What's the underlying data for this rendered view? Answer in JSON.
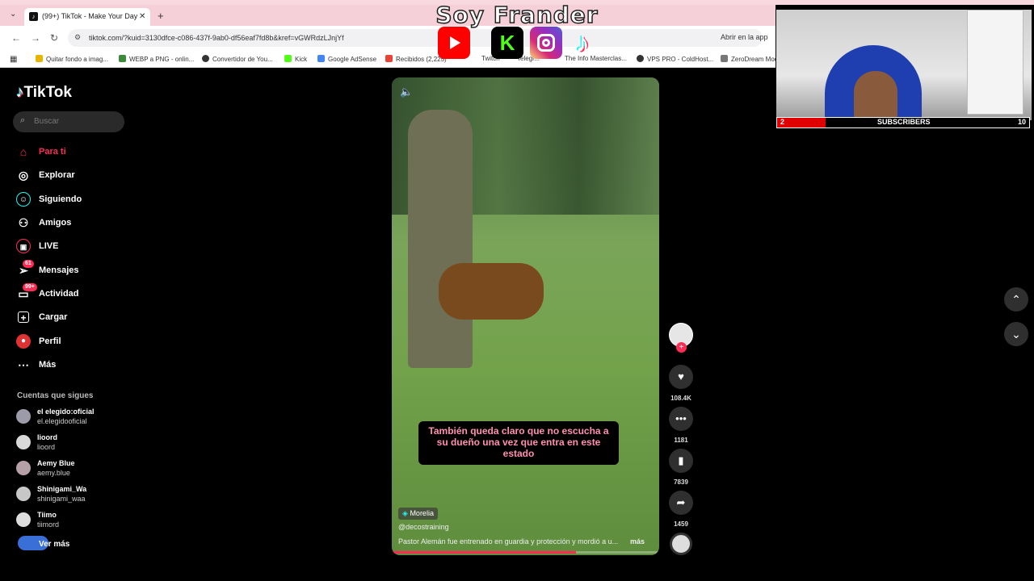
{
  "browser": {
    "tab_title": "(99+) TikTok - Make Your Day",
    "url": "tiktok.com/?kuid=3130dfce-c086-437f-9ab0-df56eaf7fd8b&kref=vGWRdzLJnjYf",
    "open_in_app": "Abrir en la app",
    "bookmarks": [
      "Quitar fondo a imag...",
      "WEBP a PNG - onlin...",
      "Convertidor de You...",
      "Kick",
      "Google AdSense",
      "Recibidos (2,225)",
      "Twitch",
      "Telegr...",
      "The Info Masterclas...",
      "VPS PRO - ColdHost...",
      "ZeroDream Mod"
    ]
  },
  "overlay": {
    "banner_title": "Soy Frander",
    "subscribers_current": "2",
    "subscribers_label": "SUBSCRIBERS",
    "subscribers_goal": "10"
  },
  "sidebar": {
    "brand": "TikTok",
    "search_placeholder": "Buscar",
    "nav": [
      {
        "label": "Para ti",
        "icon": "home-icon"
      },
      {
        "label": "Explorar",
        "icon": "compass-icon"
      },
      {
        "label": "Siguiendo",
        "icon": "following-icon"
      },
      {
        "label": "Amigos",
        "icon": "friends-icon"
      },
      {
        "label": "LIVE",
        "icon": "live-icon"
      },
      {
        "label": "Mensajes",
        "icon": "messages-icon",
        "badge": "61"
      },
      {
        "label": "Actividad",
        "icon": "activity-icon",
        "badge": "99+"
      },
      {
        "label": "Cargar",
        "icon": "upload-icon"
      },
      {
        "label": "Perfil",
        "icon": "profile-icon"
      },
      {
        "label": "Más",
        "icon": "more-icon"
      }
    ],
    "following_header": "Cuentas que sigues",
    "following": [
      {
        "name": "el elegido:oficial",
        "user": "el.elegidooficial"
      },
      {
        "name": "lioord",
        "user": "lioord"
      },
      {
        "name": "Aemy Blue",
        "user": "aemy.blue"
      },
      {
        "name": "Shinigami_Wa",
        "user": "shinigami_waa"
      },
      {
        "name": "Tiimo",
        "user": "tiimord"
      }
    ],
    "see_more": "Ver más"
  },
  "video": {
    "caption": "También queda claro que no escucha a su dueño una vez que entra en este estado",
    "location": "Morelia",
    "username": "@decostraining",
    "description": "Pastor Alemán fue entrenado en guardia y protección y mordió a u...",
    "more": "más",
    "progress": 0.69
  },
  "actions": {
    "likes": "108.4K",
    "comments": "1181",
    "saves": "7839",
    "shares": "1459"
  }
}
